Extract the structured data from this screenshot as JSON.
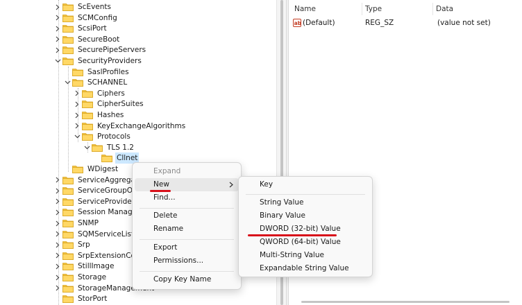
{
  "tree": {
    "items": [
      {
        "label": "ScEvents",
        "expanded": false
      },
      {
        "label": "SCMConfig",
        "expanded": false
      },
      {
        "label": "ScsiPort",
        "expanded": false
      },
      {
        "label": "SecureBoot",
        "expanded": false
      },
      {
        "label": "SecurePipeServers",
        "expanded": false
      },
      {
        "label": "SecurityProviders",
        "expanded": true
      },
      {
        "label": "SaslProfiles",
        "expanded": false
      },
      {
        "label": "SCHANNEL",
        "expanded": true
      },
      {
        "label": "Ciphers",
        "expanded": false
      },
      {
        "label": "CipherSuites",
        "expanded": false
      },
      {
        "label": "Hashes",
        "expanded": false
      },
      {
        "label": "KeyExchangeAlgorithms",
        "expanded": false
      },
      {
        "label": "Protocols",
        "expanded": true
      },
      {
        "label": "TLS 1.2",
        "expanded": true
      },
      {
        "label": "Cllnet",
        "expanded": false,
        "selected": true
      },
      {
        "label": "WDigest",
        "expanded": false
      },
      {
        "label": "ServiceAggregate",
        "expanded": false
      },
      {
        "label": "ServiceGroupOrde",
        "expanded": false
      },
      {
        "label": "ServiceProvider",
        "expanded": false
      },
      {
        "label": "Session Manager",
        "expanded": false
      },
      {
        "label": "SNMP",
        "expanded": false
      },
      {
        "label": "SQMServiceList",
        "expanded": false
      },
      {
        "label": "Srp",
        "expanded": false
      },
      {
        "label": "SrpExtensionConf",
        "expanded": false
      },
      {
        "label": "StillImage",
        "expanded": false
      },
      {
        "label": "Storage",
        "expanded": false
      },
      {
        "label": "StorageManagement",
        "expanded": false
      },
      {
        "label": "StorPort",
        "expanded": false
      }
    ]
  },
  "values": {
    "columns": {
      "name": "Name",
      "type": "Type",
      "data": "Data"
    },
    "rows": [
      {
        "name": "(Default)",
        "type": "REG_SZ",
        "data": "(value not set)"
      }
    ]
  },
  "context_menu": {
    "expand": "Expand",
    "new": "New",
    "find": "Find...",
    "delete": "Delete",
    "rename": "Rename",
    "export": "Export",
    "permissions": "Permissions...",
    "copy_key_name": "Copy Key Name"
  },
  "new_submenu": {
    "key": "Key",
    "string_value": "String Value",
    "binary_value": "Binary Value",
    "dword_value": "DWORD (32-bit) Value",
    "qword_value": "QWORD (64-bit) Value",
    "multi_string_value": "Multi-String Value",
    "expandable_string_value": "Expandable String Value"
  },
  "colors": {
    "folder": "#f5c542",
    "selection": "#cce8ff",
    "annotation_underline": "#d8101a"
  }
}
